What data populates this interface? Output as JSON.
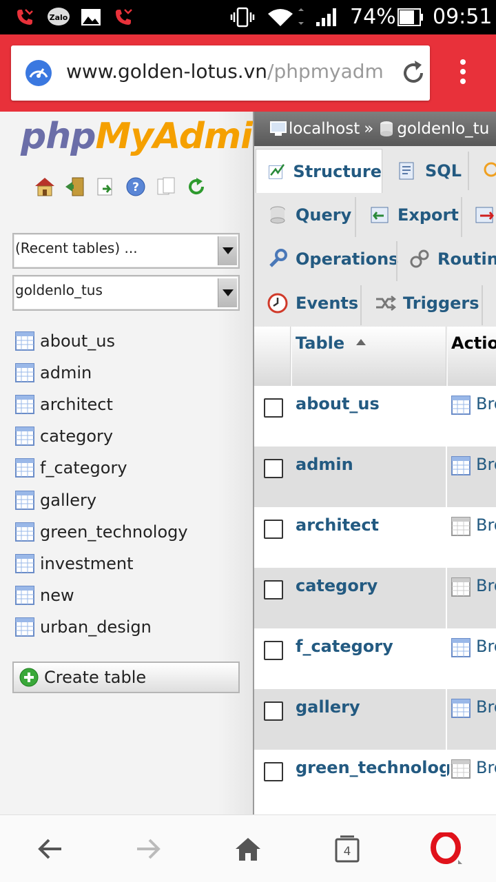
{
  "status_bar": {
    "battery_percent": "74%",
    "time": "09:51",
    "icons": [
      "missed-call-icon",
      "zalo-icon",
      "image-icon",
      "missed-call-icon",
      "vibrate-icon",
      "wifi-icon",
      "signal-icon",
      "battery-icon"
    ]
  },
  "browser": {
    "url_host": "www.golden-lotus.vn",
    "url_path": "/phpmyadm",
    "tab_count": "4"
  },
  "nav": {
    "logo_php": "php",
    "logo_myadmin": "MyAdmin",
    "recent_tables_label": "(Recent tables) ...",
    "database_select": "goldenlo_tus",
    "tables": [
      "about_us",
      "admin",
      "architect",
      "category",
      "f_category",
      "gallery",
      "green_technology",
      "investment",
      "new",
      "urban_design"
    ],
    "create_table_label": "Create table"
  },
  "breadcrumb": {
    "server": "localhost",
    "separator": "»",
    "database": "goldenlo_tu"
  },
  "tabs": {
    "structure": "Structure",
    "sql": "SQL",
    "query": "Query",
    "export": "Export",
    "operations": "Operations",
    "routines": "Routine",
    "events": "Events",
    "triggers": "Triggers"
  },
  "table_header": {
    "table": "Table",
    "action": "Action"
  },
  "rows": [
    {
      "name": "about_us",
      "action": "Bro"
    },
    {
      "name": "admin",
      "action": "Bro"
    },
    {
      "name": "architect",
      "action": "Bro"
    },
    {
      "name": "category",
      "action": "Bro"
    },
    {
      "name": "f_category",
      "action": "Bro"
    },
    {
      "name": "gallery",
      "action": "Bro"
    },
    {
      "name": "green_technology",
      "action": "Bro"
    }
  ],
  "colors": {
    "browser_bar": "#e8313a",
    "link_blue": "#235a81",
    "logo_php": "#6b6ea8",
    "logo_myadmin": "#f5a000"
  }
}
